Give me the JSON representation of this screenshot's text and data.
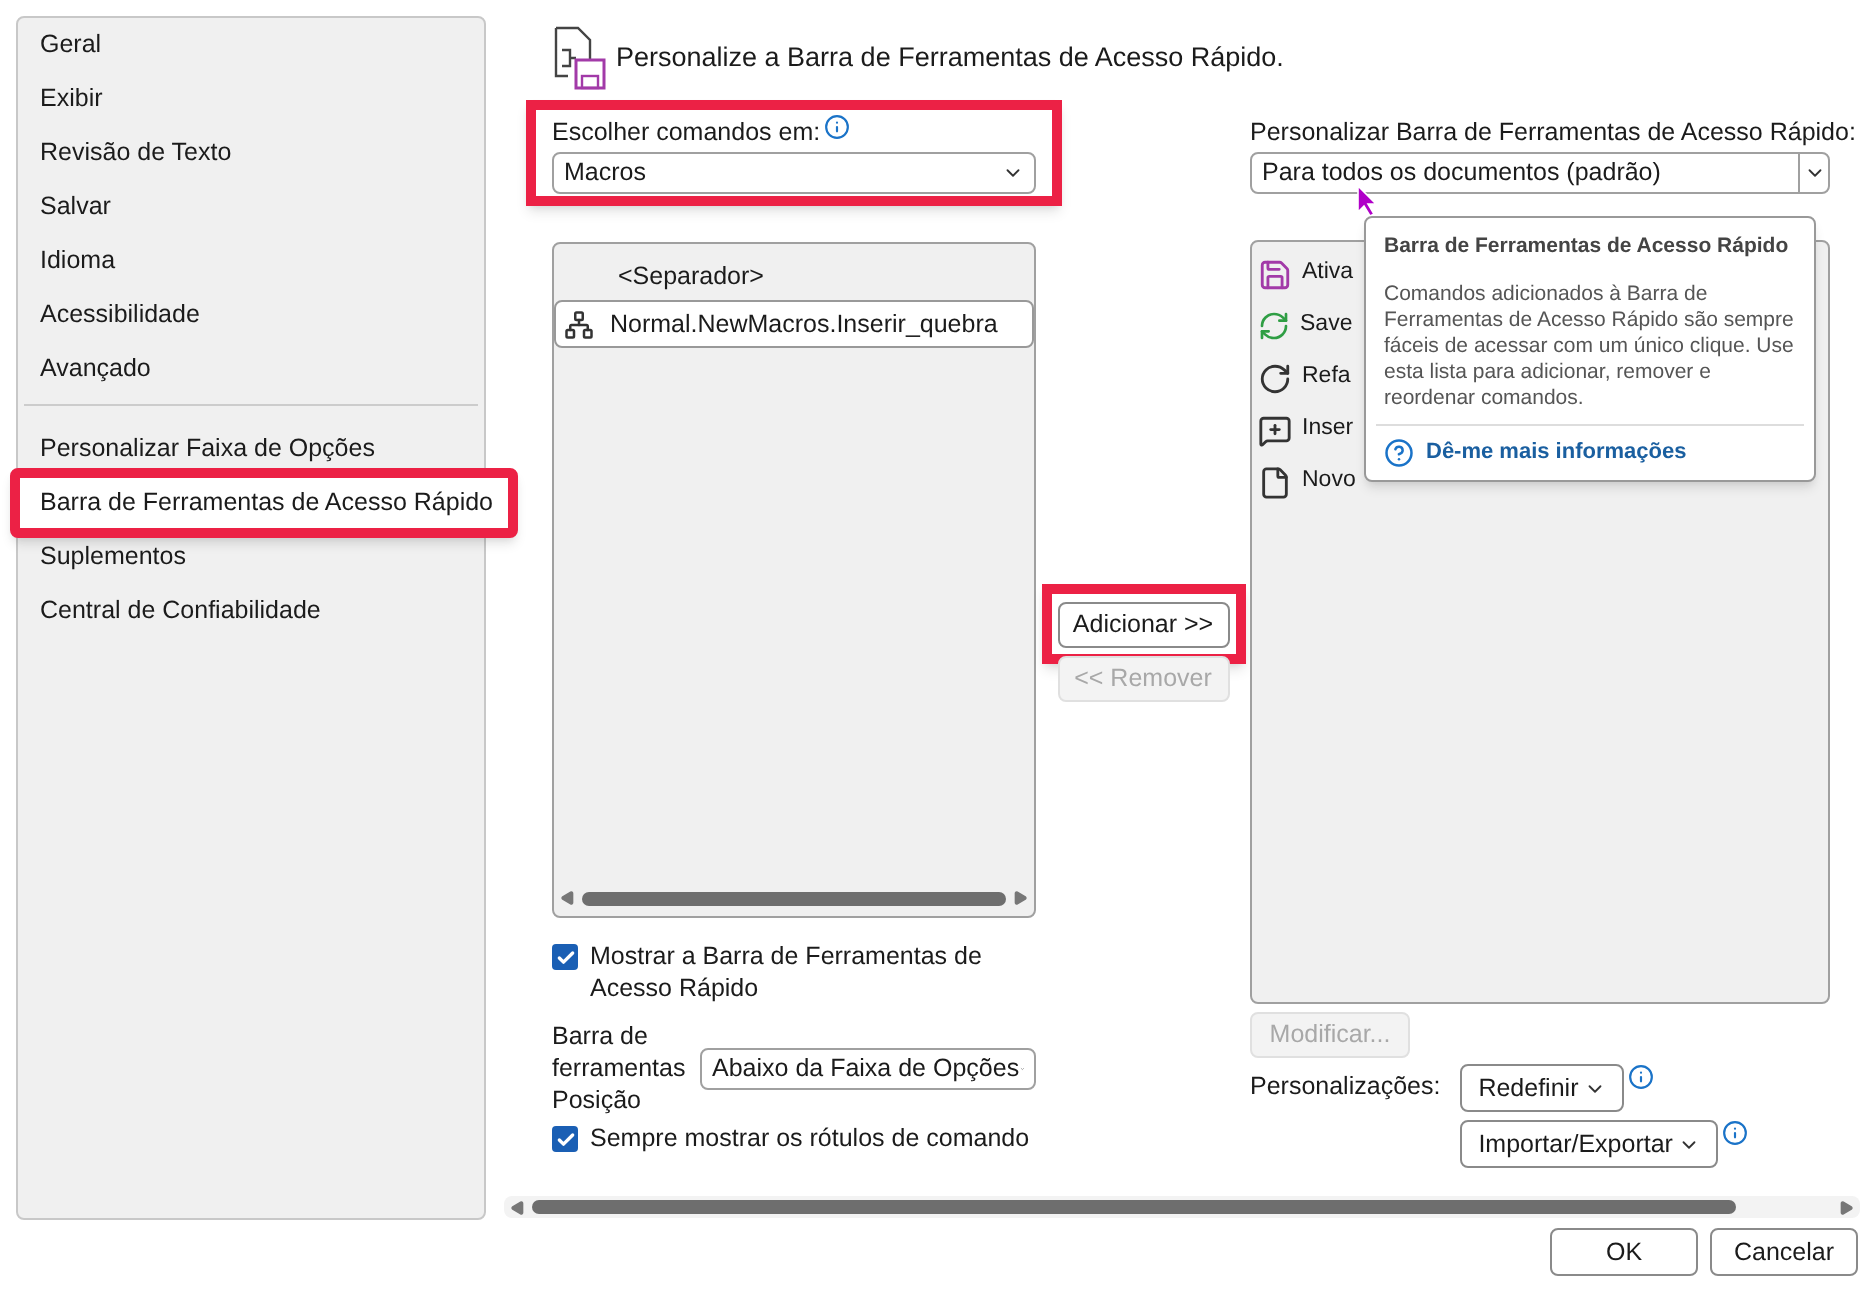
{
  "sidebar": {
    "groups": [
      [
        {
          "label": "Geral",
          "selected": false,
          "highlighted": false
        },
        {
          "label": "Exibir",
          "selected": false,
          "highlighted": false
        },
        {
          "label": "Revisão de Texto",
          "selected": false,
          "highlighted": false
        },
        {
          "label": "Salvar",
          "selected": false,
          "highlighted": false
        },
        {
          "label": "Idioma",
          "selected": false,
          "highlighted": false
        },
        {
          "label": "Acessibilidade",
          "selected": false,
          "highlighted": false
        },
        {
          "label": "Avançado",
          "selected": false,
          "highlighted": false
        }
      ],
      [
        {
          "label": "Personalizar Faixa de Opções",
          "selected": false,
          "highlighted": false
        },
        {
          "label": "Barra de Ferramentas de Acesso Rápido",
          "selected": true,
          "highlighted": true
        },
        {
          "label": "Suplementos",
          "selected": false,
          "highlighted": false
        },
        {
          "label": "Central de Confiabilidade",
          "selected": false,
          "highlighted": false
        }
      ]
    ]
  },
  "header": {
    "title": "Personalize a Barra de Ferramentas de Acesso Rápido."
  },
  "commands_source": {
    "label": "Escolher comandos em:",
    "value": "Macros",
    "highlighted": true
  },
  "commands_list": {
    "items": [
      {
        "kind": "separator",
        "label": "<Separador>",
        "selected": false
      },
      {
        "kind": "macro",
        "label": "Normal.NewMacros.Inserir_quebra",
        "selected": true
      }
    ]
  },
  "add_button": {
    "label": "Adicionar >>",
    "disabled": false,
    "highlighted": true
  },
  "remove_button": {
    "label": "<< Remover",
    "disabled": true,
    "highlighted": false
  },
  "show_toolbar": {
    "label": "Mostrar a Barra de Ferramentas de Acesso Rápido",
    "checked": true
  },
  "toolbar_position": {
    "label": "Barra de ferramentas Posição",
    "value": "Abaixo da Faixa de Opções"
  },
  "always_show_labels": {
    "label": "Sempre mostrar os rótulos de comando",
    "checked": true
  },
  "qat_scope": {
    "label": "Personalizar Barra de Ferramentas de Acesso Rápido:",
    "value": "Para todos os documentos (padrão)"
  },
  "qat_list": {
    "items": [
      {
        "kind": "save",
        "label": "Ativa"
      },
      {
        "kind": "sync",
        "label": "Save"
      },
      {
        "kind": "redo",
        "label": "Refa"
      },
      {
        "kind": "comment",
        "label": "Inser"
      },
      {
        "kind": "file",
        "label": "Novo"
      }
    ]
  },
  "modify_button": {
    "label": "Modificar...",
    "disabled": true,
    "highlighted": false
  },
  "customizations": {
    "label": "Personalizações:",
    "reset": "Redefinir",
    "import_export": "Importar/Exportar"
  },
  "tooltip": {
    "title": "Barra de Ferramentas de Acesso Rápido",
    "body": "Comandos adicionados à Barra de Ferramentas de Acesso Rápido são sempre fáceis de acessar com um único clique. Use esta lista para adicionar, remover e reordenar comandos.",
    "link": "Dê-me mais informações"
  },
  "buttons": [
    "OK",
    "Cancelar"
  ]
}
